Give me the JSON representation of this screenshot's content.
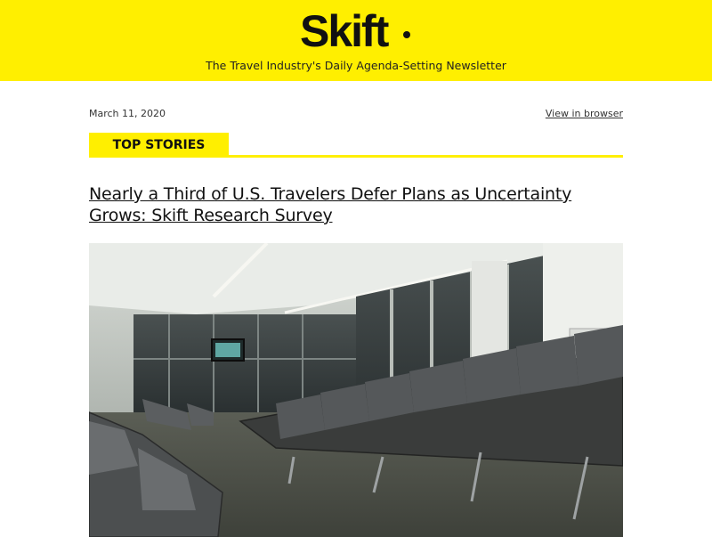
{
  "header": {
    "logo_text": "Skift",
    "tagline": "The Travel Industry's Daily Agenda-Setting Newsletter",
    "brand_color": "#ffef00"
  },
  "meta": {
    "date": "March 11, 2020",
    "view_in_browser": "View in browser"
  },
  "section": {
    "label": "TOP STORIES"
  },
  "story": {
    "headline": "Nearly a Third of U.S. Travelers Defer Plans as Uncertainty Grows: Skift Research Survey",
    "image_subject": "empty airport gate seating"
  }
}
